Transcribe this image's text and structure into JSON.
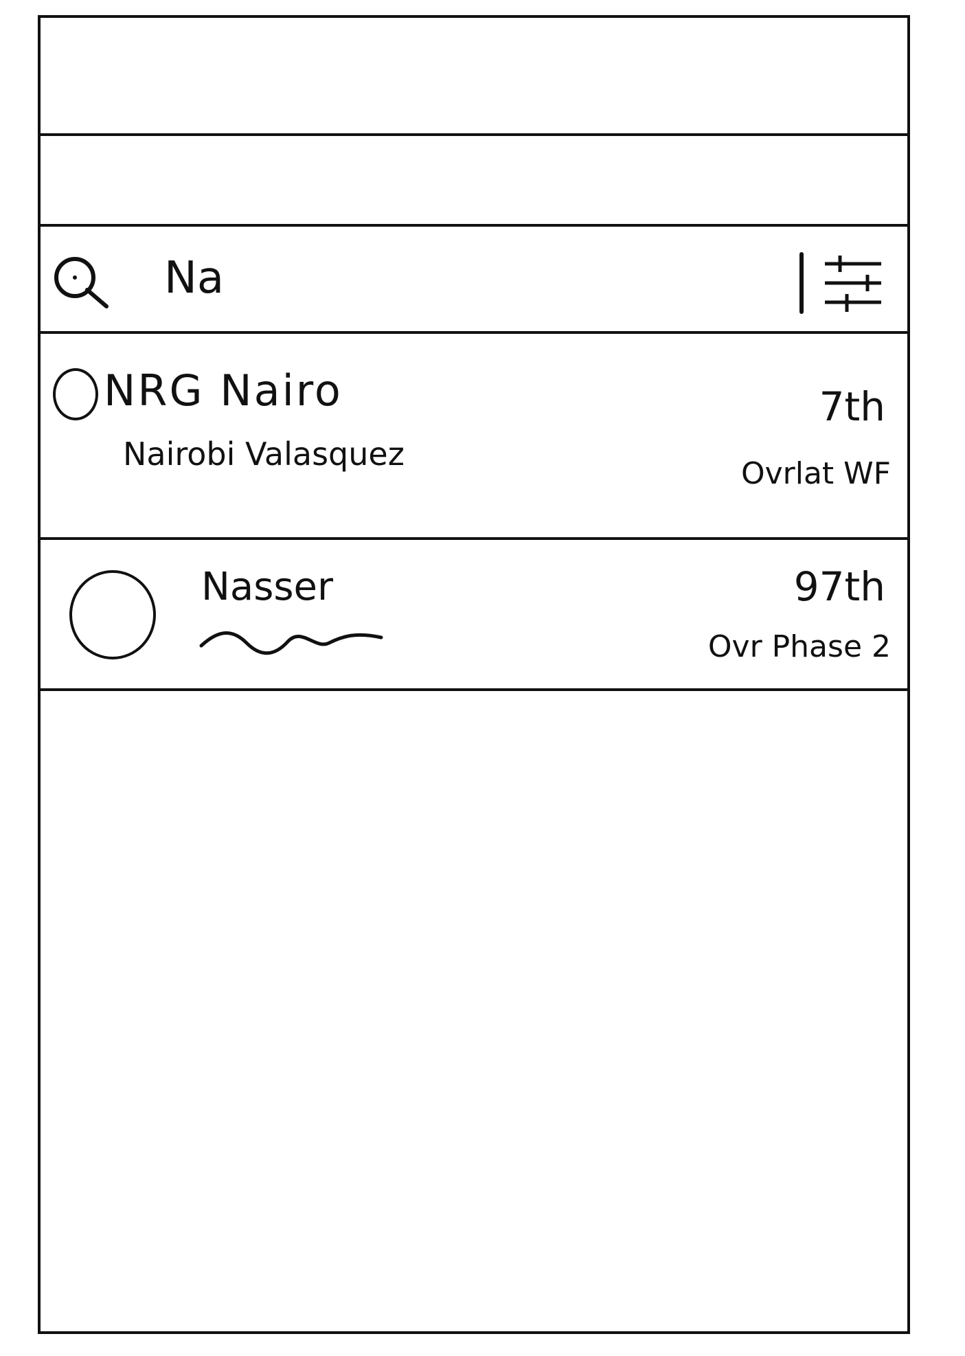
{
  "search": {
    "query": "Na",
    "icon": "search-icon",
    "filter_icon": "filter-icon"
  },
  "results": [
    {
      "tag": "NRG Nairo",
      "subtitle": "Nairobi Valasquez",
      "rank": "7th",
      "event": "Ovrlat WF"
    },
    {
      "tag": "Nasser",
      "subtitle": "",
      "rank": "97th",
      "event": "Ovr Phase 2"
    }
  ],
  "colors": {
    "ink": "#111111",
    "background": "#ffffff"
  }
}
